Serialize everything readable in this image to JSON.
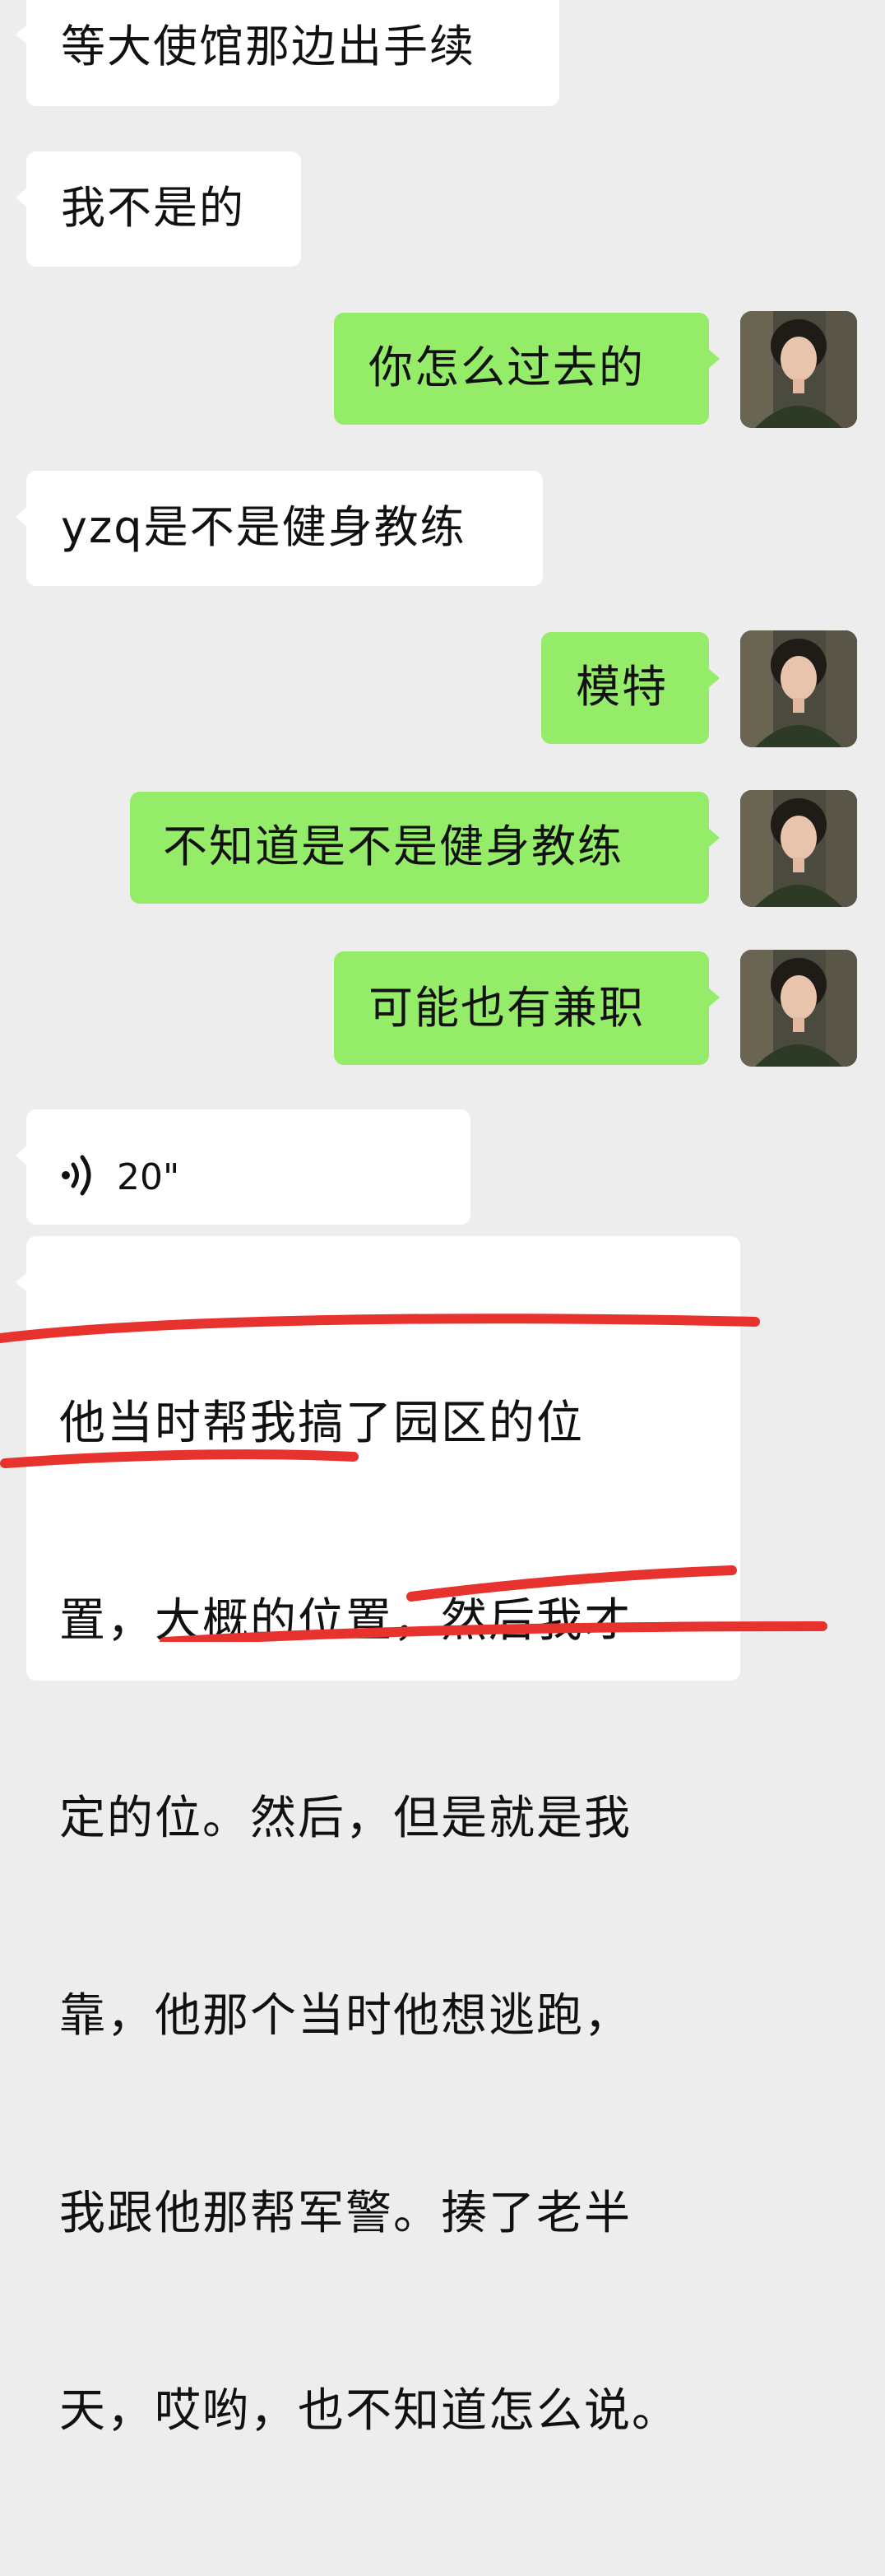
{
  "messages": [
    {
      "side": "in",
      "text": "等大使馆那边出手续"
    },
    {
      "side": "in",
      "text": "我不是的"
    },
    {
      "side": "out",
      "text": "你怎么过去的"
    },
    {
      "side": "in",
      "text": "yzq是不是健身教练"
    },
    {
      "side": "out",
      "text": "模特"
    },
    {
      "side": "out",
      "text": "不知道是不是健身教练"
    },
    {
      "side": "out",
      "text": "可能也有兼职"
    },
    {
      "side": "in",
      "type": "voice",
      "duration": "20\""
    },
    {
      "side": "in",
      "lines": [
        "他当时帮我搞了园区的位",
        "置，大概的位置，然后我才",
        "定的位。然后，但是就是我",
        "靠，他那个当时他想逃跑，",
        "我跟他那帮军警。揍了老半",
        "天，哎哟，也不知道怎么说。"
      ]
    }
  ],
  "colors": {
    "background": "#ededed",
    "incoming_bubble": "#ffffff",
    "outgoing_bubble": "#95ec69",
    "annotation_marker": "#e8322e"
  },
  "icons": {
    "voice": "voice-wave-icon",
    "avatar": "user-avatar"
  }
}
